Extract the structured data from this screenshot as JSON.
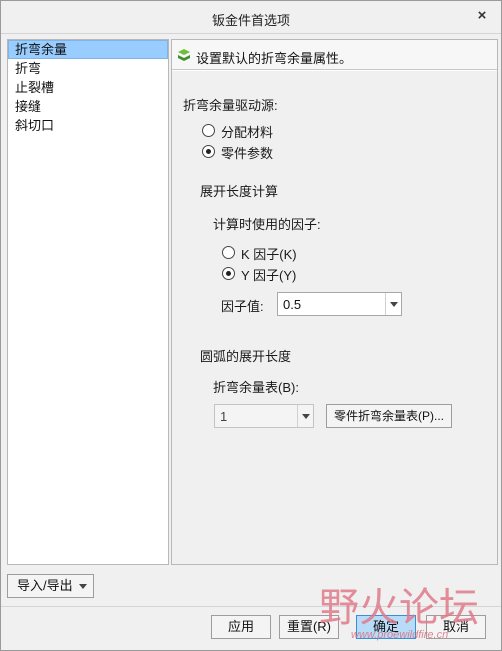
{
  "window": {
    "title": "钣金件首选项",
    "close_label": "×"
  },
  "nav": {
    "items": [
      {
        "label": "折弯余量",
        "selected": true
      },
      {
        "label": "折弯",
        "selected": false
      },
      {
        "label": "止裂槽",
        "selected": false
      },
      {
        "label": "接缝",
        "selected": false
      },
      {
        "label": "斜切口",
        "selected": false
      }
    ]
  },
  "info": {
    "text": "设置默认的折弯余量属性。",
    "icon": "sheetmetal-icon"
  },
  "bend_source": {
    "label": "折弯余量驱动源:",
    "options": [
      {
        "label": "分配材料",
        "checked": false
      },
      {
        "label": "零件参数",
        "checked": true
      }
    ]
  },
  "developed_length": {
    "label": "展开长度计算",
    "factor_label": "计算时使用的因子:",
    "factor_options": [
      {
        "label": "K 因子(K)",
        "checked": false
      },
      {
        "label": "Y 因子(Y)",
        "checked": true
      }
    ],
    "factor_value_label": "因子值:",
    "factor_value": "0.5"
  },
  "arc_length": {
    "label": "圆弧的展开长度",
    "table_label": "折弯余量表(B):",
    "table_value": "1",
    "table_button": "零件折弯余量表(P)..."
  },
  "footer": {
    "import_export": "导入/导出",
    "apply": "应用",
    "reset": "重置(R)",
    "ok": "确定",
    "cancel": "取消"
  },
  "watermark": {
    "text": "野火论坛",
    "url": "www.proewildfire.cn"
  }
}
